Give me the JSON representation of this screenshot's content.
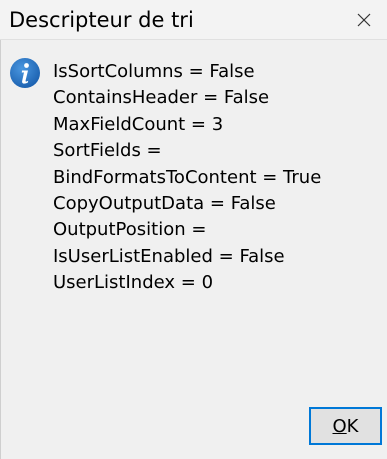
{
  "window": {
    "title": "Descripteur de tri",
    "close_icon": "close-icon"
  },
  "message": {
    "icon": "info-icon",
    "icon_color": "#1f6fbf",
    "lines": [
      "IsSortColumns = False",
      "ContainsHeader = False",
      "MaxFieldCount = 3",
      "SortFields = ",
      "BindFormatsToContent = True",
      "CopyOutputData = False",
      "OutputPosition = ",
      "IsUserListEnabled = False",
      "UserListIndex = 0"
    ]
  },
  "buttons": {
    "ok_mnemonic": "O",
    "ok_rest": "K",
    "ok_focus_color": "#0078d7"
  }
}
